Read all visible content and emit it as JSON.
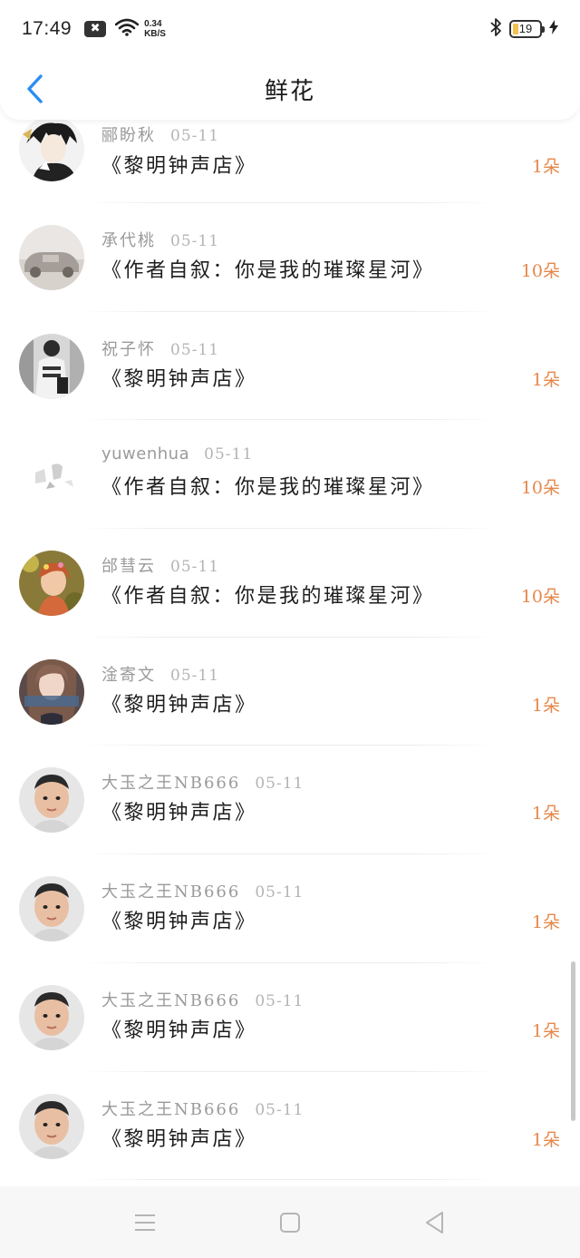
{
  "status_bar": {
    "time": "17:49",
    "notification_glyph": "✖",
    "net_speed_value": "0.34",
    "net_speed_unit": "KB/S",
    "battery_level": "19"
  },
  "header": {
    "title": "鲜花",
    "back_icon": "chevron-left-icon",
    "accent_color": "#2b8df5"
  },
  "colors": {
    "count_color": "#e5884a",
    "name_color": "#9a9a9a"
  },
  "gifts": [
    {
      "name": "郦盼秋",
      "date": "05-11",
      "book": "《黎明钟声店》",
      "count": "1朵"
    },
    {
      "name": "承代桃",
      "date": "05-11",
      "book": "《作者自叙：你是我的璀璨星河》",
      "count": "10朵"
    },
    {
      "name": "祝子怀",
      "date": "05-11",
      "book": "《黎明钟声店》",
      "count": "1朵"
    },
    {
      "name": "yuwenhua",
      "date": "05-11",
      "book": "《作者自叙：你是我的璀璨星河》",
      "count": "10朵"
    },
    {
      "name": "邰彗云",
      "date": "05-11",
      "book": "《作者自叙：你是我的璀璨星河》",
      "count": "10朵"
    },
    {
      "name": "淦寄文",
      "date": "05-11",
      "book": "《黎明钟声店》",
      "count": "1朵"
    },
    {
      "name": "大玉之王NB666",
      "date": "05-11",
      "book": "《黎明钟声店》",
      "count": "1朵"
    },
    {
      "name": "大玉之王NB666",
      "date": "05-11",
      "book": "《黎明钟声店》",
      "count": "1朵"
    },
    {
      "name": "大玉之王NB666",
      "date": "05-11",
      "book": "《黎明钟声店》",
      "count": "1朵"
    },
    {
      "name": "大玉之王NB666",
      "date": "05-11",
      "book": "《黎明钟声店》",
      "count": "1朵"
    }
  ],
  "nav_bar": {
    "menu_icon": "menu-icon",
    "home_icon": "square-home-icon",
    "back_icon": "triangle-back-icon"
  }
}
